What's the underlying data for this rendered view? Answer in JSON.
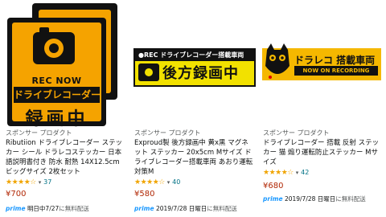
{
  "products": [
    {
      "sticker": {
        "rec_now": "REC NOW",
        "line": "ドライブレコーダー",
        "big": "録画中"
      },
      "sponsor": "スポンサー プロダクト",
      "title": "Ributiion ドライブレコーダー ステッカー シール ドラレコステッカー 日本語説明書付き 防水 耐熱 14X12.5cm ビッグサイズ 2枚セット",
      "stars": "★★★★☆",
      "rating_count": "37",
      "price": "¥700",
      "prime": "prime",
      "ship_date": "明日中7/27",
      "ship_note": "に無料配送"
    },
    {
      "sticker": {
        "top": "●REC ドライブレコーダー搭載車両",
        "main": "後方録画中"
      },
      "sponsor": "スポンサー プロダクト",
      "title": "Exproud製 後方録画中 黄x黒 マグネット ステッカー 20x5cm Mサイズ ドライブレコーダー搭載車両 あおり運転対策M",
      "stars": "★★★★☆",
      "rating_count": "40",
      "price": "¥580",
      "prime": "prime",
      "ship_date": "2019/7/28 日曜日",
      "ship_note": "に無料配送"
    },
    {
      "sticker": {
        "t1": "ドラレコ 搭載車両",
        "t2": "NOW ON RECORDING"
      },
      "sponsor": "スポンサー プロダクト",
      "title": "ドライブレコーダー 搭載 反射 ステッカー 猫 煽り運転防止ステッカー Mサイズ",
      "stars": "★★★★☆",
      "rating_count": "42",
      "price": "¥680",
      "prime": "prime",
      "ship_date": "2019/7/28 日曜日",
      "ship_note": "に無料配送"
    }
  ]
}
